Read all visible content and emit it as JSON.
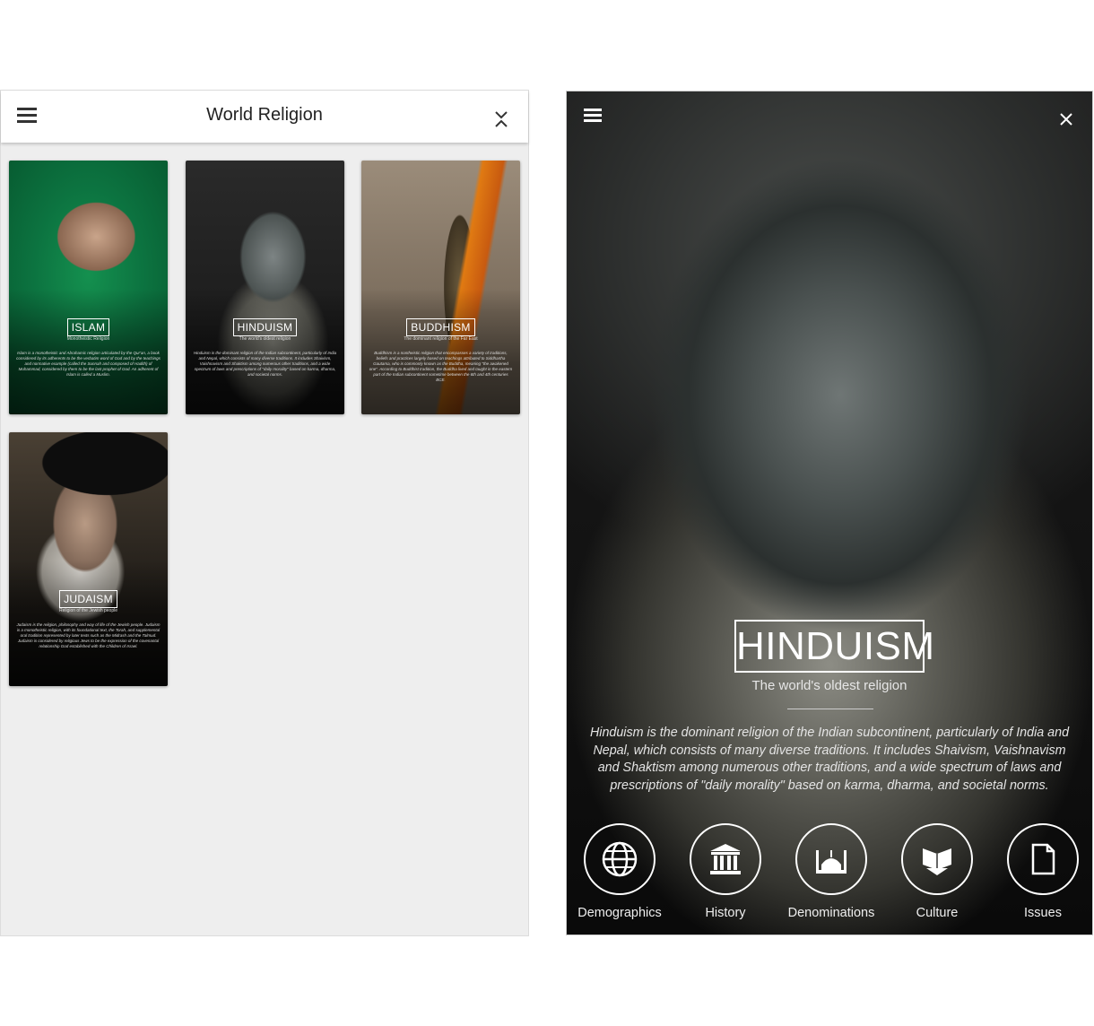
{
  "left_screen": {
    "appbar": {
      "title": "World Religion",
      "menu_icon": "hamburger-menu-icon",
      "close_icon": "close-icon"
    },
    "cards": [
      {
        "name": "ISLAM",
        "subtitle": "Monotheistic Religion",
        "description": "Islam is a monotheistic and Abrahamic religion articulated by the Qur'an, a book considered by its adherents to be the verbatim word of God and by the teachings and normative example (called the Sunnah and composed of Hadith) of Muhammad, considered by them to be the last prophet of God. An adherent of Islam is called a Muslim."
      },
      {
        "name": "HINDUISM",
        "subtitle": "The world's oldest religion",
        "description": "Hinduism is the dominant religion of the Indian subcontinent, particularly of India and Nepal, which consists of many diverse traditions. It includes Shaivism, Vaishnavism and Shaktism among numerous other traditions, and a wide spectrum of laws and prescriptions of \"daily morality\" based on karma, dharma, and societal norms."
      },
      {
        "name": "BUDDHISM",
        "subtitle": "The dominant religion of the Far East",
        "description": "Buddhism is a nontheistic religion that encompasses a variety of traditions, beliefs and practices largely based on teachings attributed to Siddhartha Gautama, who is commonly known as the Buddha, meaning \"the awakened one\". According to Buddhist tradition, the Buddha lived and taught in the eastern part of the Indian subcontinent sometime between the 6th and 4th centuries BCE."
      },
      {
        "name": "JUDAISM",
        "subtitle": "Religion of the Jewish people",
        "description": "Judaism is the religion, philosophy and way of life of the Jewish people. Judaism is a monotheistic religion, with its foundational text, the Torah, and supplemental oral tradition represented by later texts such as the Midrash and the Talmud. Judaism is considered by religious Jews to be the expression of the covenantal relationship God established with the Children of Israel."
      }
    ]
  },
  "right_screen": {
    "menu_icon": "hamburger-menu-icon",
    "close_icon": "close-icon",
    "title": "HINDUISM",
    "subtitle": "The world's oldest religion",
    "description": "Hinduism is the dominant religion of the Indian subcontinent, particularly of India and Nepal, which consists of many diverse traditions. It includes Shaivism, Vaishnavism and Shaktism among numerous other traditions, and a wide spectrum of laws and prescriptions of \"daily morality\" based on karma, dharma, and societal norms.",
    "nav": [
      {
        "label": "Demographics",
        "icon": "globe-icon"
      },
      {
        "label": "History",
        "icon": "museum-icon"
      },
      {
        "label": "Denominations",
        "icon": "mosque-icon"
      },
      {
        "label": "Culture",
        "icon": "open-book-icon"
      },
      {
        "label": "Issues",
        "icon": "document-icon"
      }
    ]
  },
  "colors": {
    "left_background": "#eeeeee",
    "appbar_background": "#ffffff",
    "islam_card_accent": "#0f7a45",
    "buddhism_card_accent": "#e07a12"
  }
}
